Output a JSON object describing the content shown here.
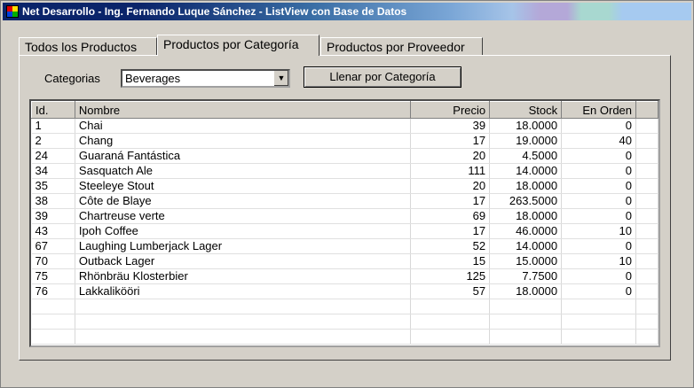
{
  "window": {
    "title": "Net Desarrollo  - Ing. Fernando Luque Sánchez - ListView con Base de Datos"
  },
  "tabs": [
    {
      "label": "Todos los Productos"
    },
    {
      "label": "Productos por Categoría"
    },
    {
      "label": "Productos por Proveedor"
    }
  ],
  "filter": {
    "label": "Categorias",
    "selected": "Beverages",
    "button_label": "Llenar por Categoría"
  },
  "table": {
    "headers": [
      "Id.",
      "Nombre",
      "Precio",
      "Stock",
      "En Orden"
    ],
    "rows": [
      [
        "1",
        "Chai",
        "39",
        "18.0000",
        "0"
      ],
      [
        "2",
        "Chang",
        "17",
        "19.0000",
        "40"
      ],
      [
        "24",
        "Guaraná Fantástica",
        "20",
        "4.5000",
        "0"
      ],
      [
        "34",
        "Sasquatch Ale",
        "111",
        "14.0000",
        "0"
      ],
      [
        "35",
        "Steeleye Stout",
        "20",
        "18.0000",
        "0"
      ],
      [
        "38",
        "Côte de Blaye",
        "17",
        "263.5000",
        "0"
      ],
      [
        "39",
        "Chartreuse verte",
        "69",
        "18.0000",
        "0"
      ],
      [
        "43",
        "Ipoh Coffee",
        "17",
        "46.0000",
        "10"
      ],
      [
        "67",
        "Laughing Lumberjack Lager",
        "52",
        "14.0000",
        "0"
      ],
      [
        "70",
        "Outback Lager",
        "15",
        "15.0000",
        "10"
      ],
      [
        "75",
        "Rhönbräu Klosterbier",
        "125",
        "7.7500",
        "0"
      ],
      [
        "76",
        "Lakkalikööri",
        "57",
        "18.0000",
        "0"
      ]
    ]
  }
}
